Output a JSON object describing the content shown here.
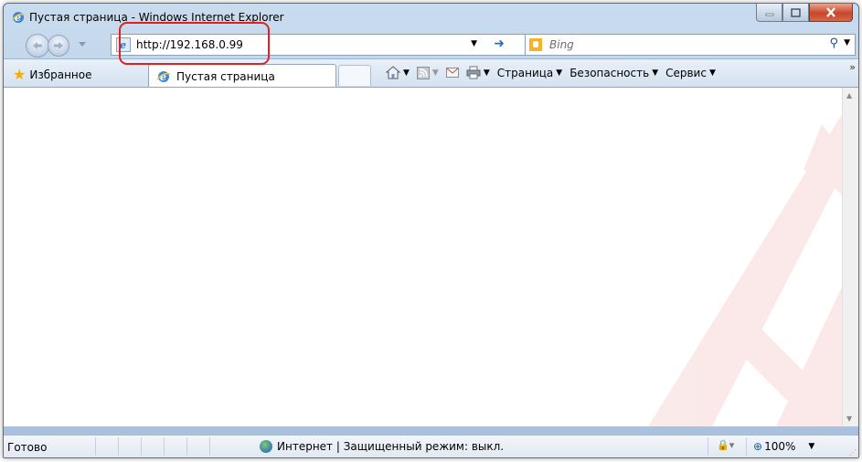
{
  "window": {
    "title": "Пустая страница - Windows Internet Explorer",
    "caption_buttons": [
      "minimize",
      "maximize",
      "close"
    ]
  },
  "navigation": {
    "address": "http://192.168.0.99",
    "search_placeholder": "Bing"
  },
  "favorites_bar": {
    "favorites_label": "Избранное",
    "tab_label": "Пустая страница"
  },
  "command_bar": {
    "page_label": "Страница",
    "security_label": "Безопасность",
    "tools_label": "Сервис"
  },
  "status_bar": {
    "status_text": "Готово",
    "zone_text": "Интернет | Защищенный режим: выкл.",
    "zoom_text": "100%"
  },
  "colors": {
    "highlight": "#e51f1f",
    "watermark": "#d71a1a",
    "frame": "#b7cde6"
  }
}
